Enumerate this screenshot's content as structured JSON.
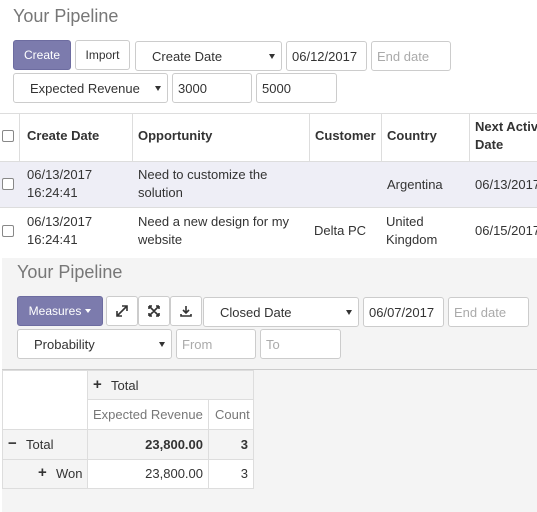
{
  "top": {
    "title": "Your Pipeline",
    "create_label": "Create",
    "import_label": "Import",
    "date_field": "Create Date",
    "start_date": "06/12/2017",
    "end_date_placeholder": "End date",
    "measure_field": "Expected Revenue",
    "min_value": "3000",
    "max_value": "5000"
  },
  "table": {
    "columns": [
      "Create Date",
      "Opportunity",
      "Customer",
      "Country",
      "Next Activity Date"
    ],
    "col_next_line1": "Next Activ",
    "col_next_line2": "Date",
    "rows": [
      {
        "date": "06/13/2017",
        "time": "16:24:41",
        "opp_line1": "Need to customize the",
        "opp_line2": "solution",
        "customer": "",
        "country_line1": "Argentina",
        "country_line2": "",
        "next": "06/13/2017"
      },
      {
        "date": "06/13/2017",
        "time": "16:24:41",
        "opp_line1": "Need a new design for my",
        "opp_line2": "website",
        "customer": "Delta PC",
        "country_line1": "United",
        "country_line2": "Kingdom",
        "next": "06/15/2017"
      }
    ]
  },
  "bottom": {
    "title": "Your Pipeline",
    "measures_label": "Measures",
    "date_field": "Closed Date",
    "start_date": "06/07/2017",
    "end_date_placeholder": "End date",
    "measure_field": "Probability",
    "from_placeholder": "From",
    "to_placeholder": "To"
  },
  "pivot": {
    "col_header": "Total",
    "measure_header": "Expected Revenue",
    "count_header": "Count",
    "rows": [
      {
        "label": "Total",
        "revenue": "23,800.00",
        "count": "3"
      },
      {
        "label": "Won",
        "revenue": "23,800.00",
        "count": "3"
      }
    ]
  },
  "colors": {
    "primary": "#7c7bad",
    "border": "#dddddd",
    "selected_row": "#eeeef6"
  },
  "icons": [
    "expand-icon",
    "fullscreen-icon",
    "download-icon",
    "plus-icon",
    "minus-icon",
    "caret-down-icon"
  ]
}
